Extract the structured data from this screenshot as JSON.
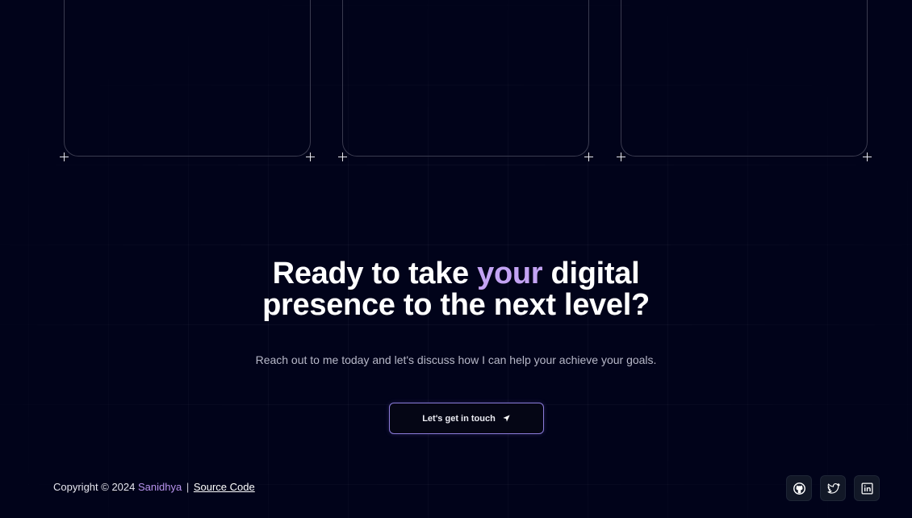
{
  "hero": {
    "title_before": "Ready to take ",
    "title_accent": "your",
    "title_after": " digital presence to the next level?",
    "subtitle": "Reach out to me today and let's discuss how I can help your achieve your goals.",
    "cta_label": "Let's get in touch",
    "cta_icon": "send-arrow-icon"
  },
  "footer": {
    "copyright": "Copyright © 2024 ",
    "author": "Sanidhya",
    "separator": "|",
    "source_link": "Source Code",
    "socials": [
      {
        "name": "github",
        "icon": "github-icon"
      },
      {
        "name": "twitter",
        "icon": "twitter-icon"
      },
      {
        "name": "linkedin",
        "icon": "linkedin-icon"
      }
    ]
  },
  "colors": {
    "background": "#01031a",
    "accent": "#c3a3f3",
    "author": "#b894ee",
    "button_border": "#8a7ad8"
  }
}
